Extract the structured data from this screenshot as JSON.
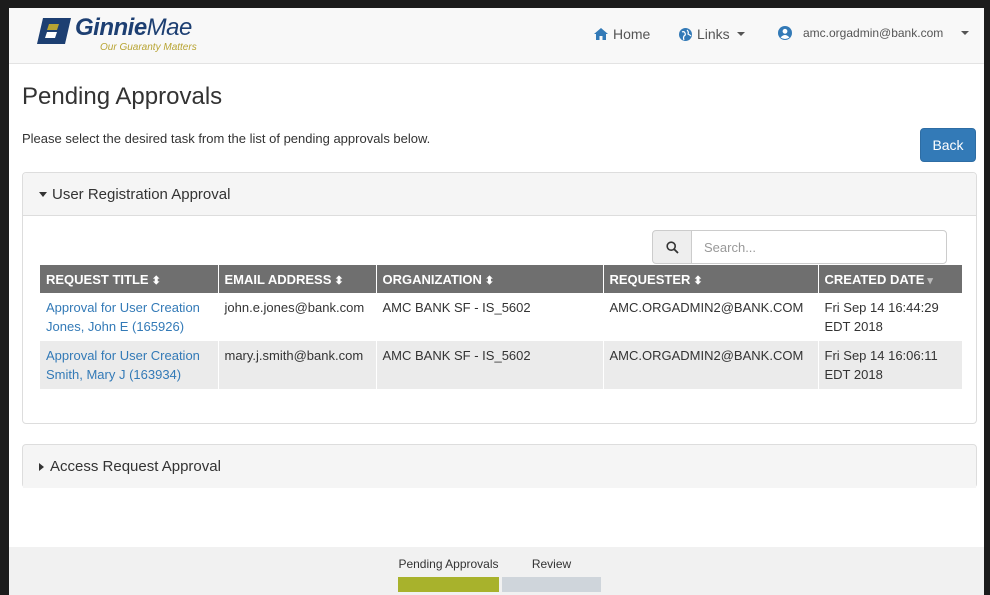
{
  "brand": {
    "name_bold": "Ginnie",
    "name_light": "Mae",
    "tagline": "Our Guaranty Matters",
    "primary_color": "#1d3f72",
    "accent_color": "#b8a433"
  },
  "nav": {
    "home_label": "Home",
    "home_icon": "home-icon",
    "links_label": "Links",
    "links_icon": "globe-icon",
    "user_email": "amc.orgadmin@bank.com",
    "user_icon": "user-circle-icon"
  },
  "page": {
    "title": "Pending Approvals",
    "instructions": "Please select the desired task from the list of pending approvals below.",
    "back_label": "Back"
  },
  "user_panel": {
    "heading": "User Registration Approval",
    "search_placeholder": "Search...",
    "columns": [
      {
        "label": "REQUEST TITLE",
        "sort": "⬍"
      },
      {
        "label": "EMAIL ADDRESS",
        "sort": "⬍"
      },
      {
        "label": "ORGANIZATION",
        "sort": "⬍"
      },
      {
        "label": "REQUESTER",
        "sort": "⬍"
      },
      {
        "label": "CREATED DATE",
        "sort": "▾"
      }
    ],
    "rows": [
      {
        "title_line1": "Approval for User Creation",
        "title_line2": "Jones, John E (165926)",
        "email": "john.e.jones@bank.com",
        "organization": "AMC BANK SF - IS_5602",
        "requester": "AMC.ORGADMIN2@BANK.COM",
        "date_line1": "Fri Sep 14 16:44:29",
        "date_line2": "EDT 2018"
      },
      {
        "title_line1": "Approval for User Creation",
        "title_line2": "Smith, Mary J (163934)",
        "email": "mary.j.smith@bank.com",
        "organization": "AMC BANK SF - IS_5602",
        "requester": "AMC.ORGADMIN2@BANK.COM",
        "date_line1": "Fri Sep 14 16:06:11",
        "date_line2": "EDT 2018"
      }
    ]
  },
  "access_panel": {
    "heading": "Access Request Approval"
  },
  "progress": {
    "steps": [
      {
        "label": "Pending Approvals",
        "state": "active",
        "color": "#a8b22c"
      },
      {
        "label": "Review",
        "state": "inactive",
        "color": "#cfd5db"
      }
    ]
  }
}
